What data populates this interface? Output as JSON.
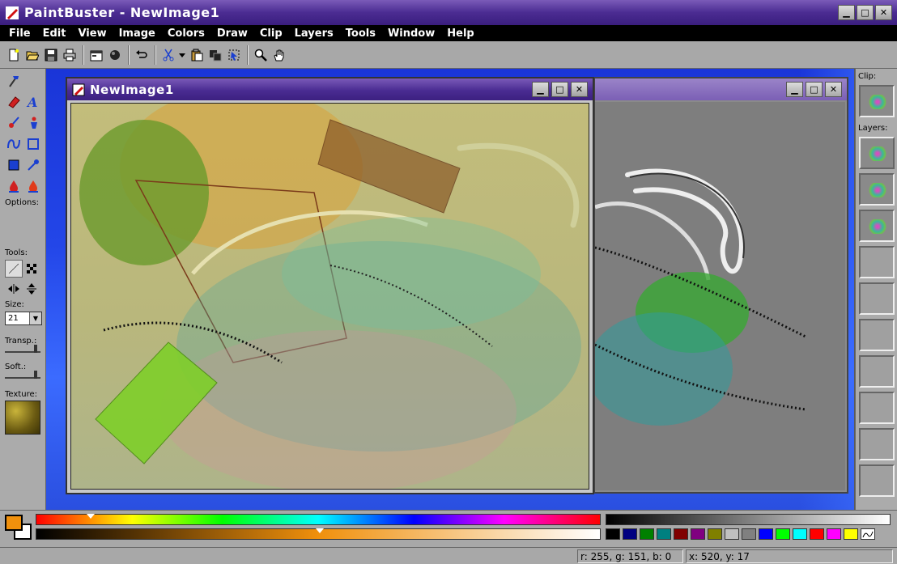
{
  "app": {
    "title": "PaintBuster - NewImage1"
  },
  "menu": [
    "File",
    "Edit",
    "View",
    "Image",
    "Colors",
    "Draw",
    "Clip",
    "Layers",
    "Tools",
    "Window",
    "Help"
  ],
  "toolbar": {
    "icons": [
      "new-file-icon",
      "open-folder-icon",
      "save-icon",
      "print-icon",
      "properties-icon",
      "sphere-icon",
      "undo-icon",
      "cut-icon",
      "dropdown-arrow-icon",
      "paste-icon",
      "copy-icon",
      "select-icon",
      "zoom-icon",
      "hand-icon"
    ]
  },
  "left_panel": {
    "options_label": "Options:",
    "tools_label": "Tools:",
    "size_label": "Size:",
    "size_value": "21",
    "transp_label": "Transp.:",
    "soft_label": "Soft.:",
    "texture_label": "Texture:"
  },
  "right_panel": {
    "clip_label": "Clip:",
    "layers_label": "Layers:"
  },
  "image_window": {
    "title": "NewImage1"
  },
  "colors": {
    "foreground": "#f0900c",
    "background": "#ffffff",
    "swatches": [
      "#000000",
      "#000080",
      "#008000",
      "#008080",
      "#800000",
      "#800080",
      "#808000",
      "#c0c0c0",
      "#808080",
      "#0000ff",
      "#00ff00",
      "#00ffff",
      "#ff0000",
      "#ff00ff",
      "#ffff00"
    ]
  },
  "status": {
    "rgb": "r: 255, g: 151, b: 0",
    "coords": "x: 520, y: 17"
  }
}
